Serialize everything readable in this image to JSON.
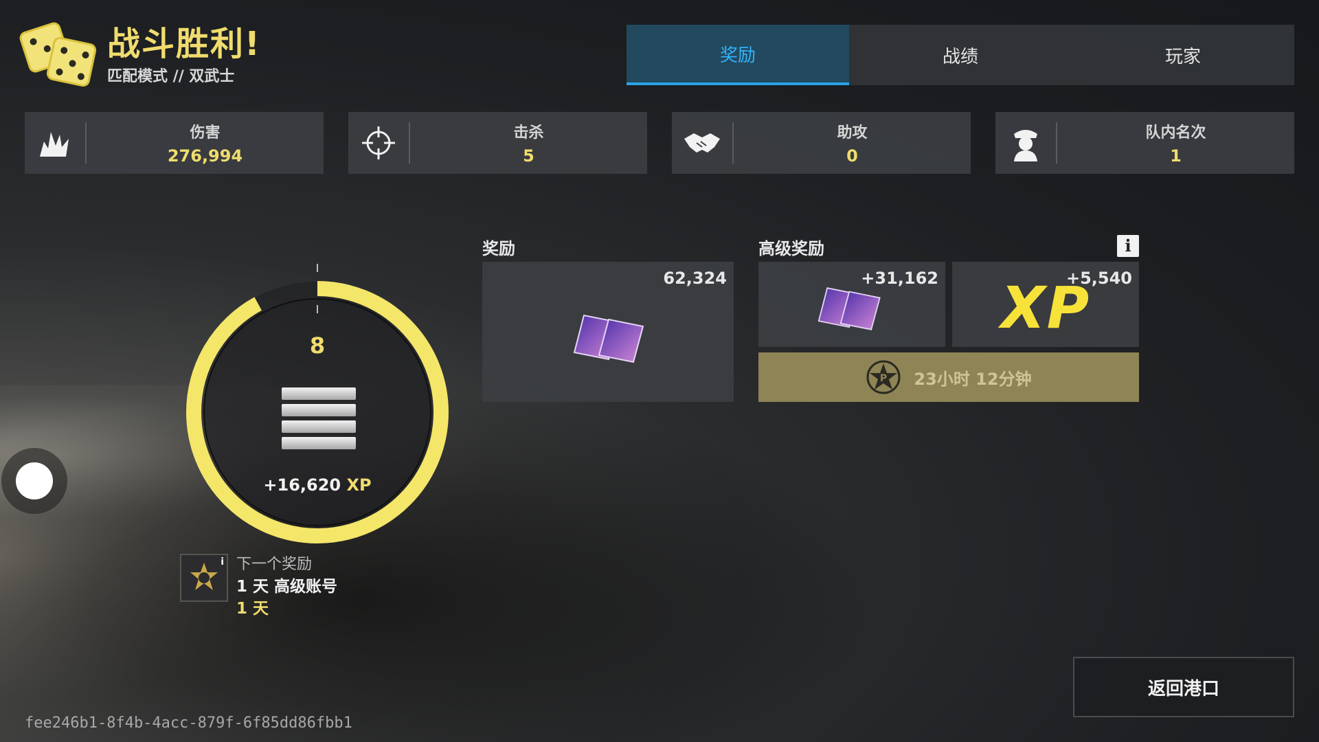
{
  "header": {
    "title": "战斗胜利!",
    "subtitle": "匹配模式 // 双武士",
    "icon": "dice-icon"
  },
  "tabs": [
    {
      "label": "奖励",
      "active": true
    },
    {
      "label": "战绩",
      "active": false
    },
    {
      "label": "玩家",
      "active": false
    }
  ],
  "stats": [
    {
      "label": "伤害",
      "value": "276,994",
      "icon": "explosion-icon"
    },
    {
      "label": "击杀",
      "value": "5",
      "icon": "crosshair-icon"
    },
    {
      "label": "助攻",
      "value": "0",
      "icon": "handshake-icon"
    },
    {
      "label": "队内名次",
      "value": "1",
      "icon": "captain-icon"
    }
  ],
  "progress": {
    "level": "8",
    "xp_label": "+16,620",
    "xp_unit": "XP",
    "ring_fraction": 0.92
  },
  "next_reward": {
    "label": "下一个奖励",
    "name": "1 天 高级账号",
    "duration": "1 天",
    "info": "i"
  },
  "rewards": {
    "label": "奖励",
    "credits_amount": "62,324",
    "premium_label": "高级奖励",
    "premium_credits_amount": "+31,162",
    "premium_xp_amount": "+5,540",
    "xp_text": "XP",
    "timer": "23小时 12分钟",
    "info": "i"
  },
  "buttons": {
    "return": "返回港口"
  },
  "session_id": "fee246b1-8f4b-4acc-879f-6f85dd86fbb1",
  "colors": {
    "accent_yellow": "#f0dc6e",
    "tab_active_bg": "#23495f",
    "tab_active_text": "#2fb4ff",
    "timer_bg": "#8f8456"
  }
}
